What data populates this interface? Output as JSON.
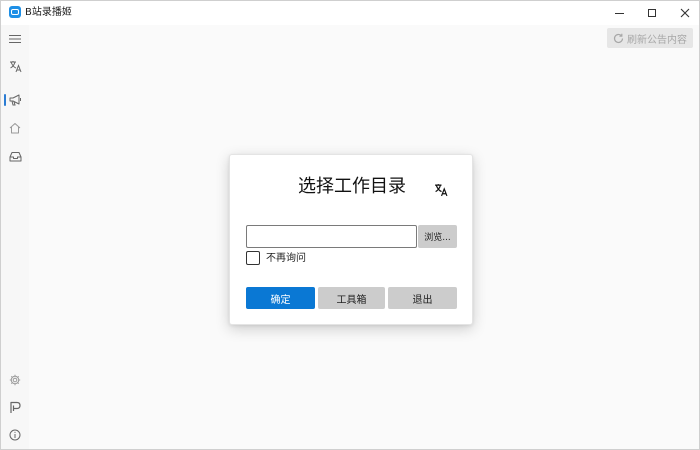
{
  "app": {
    "title": "B站录播姬",
    "icon": "bilibili-tv-icon",
    "accent_color": "#0a78d4"
  },
  "window_controls": {
    "minimize": "minimize-icon",
    "maximize": "maximize-icon",
    "close": "close-icon"
  },
  "sidebar": {
    "items": [
      {
        "name": "menu",
        "icon": "hamburger-icon"
      },
      {
        "name": "language",
        "icon": "translate-icon"
      },
      {
        "name": "announcement",
        "icon": "megaphone-icon",
        "active": true
      },
      {
        "name": "home",
        "icon": "home-icon"
      },
      {
        "name": "rooms",
        "icon": "inbox-icon"
      },
      {
        "name": "settings",
        "icon": "gear-icon"
      },
      {
        "name": "log",
        "icon": "log-icon"
      },
      {
        "name": "about",
        "icon": "info-icon"
      }
    ]
  },
  "toolbar": {
    "refresh_label": "刷新公告内容",
    "refresh_icon": "refresh-icon"
  },
  "dialog": {
    "title": "选择工作目录",
    "translate_icon": "translate-icon",
    "path_value": "",
    "path_placeholder": "",
    "browse_label": "浏览...",
    "checkbox_label": "不再询问",
    "checkbox_checked": false,
    "ok_label": "确定",
    "tools_label": "工具箱",
    "exit_label": "退出"
  }
}
